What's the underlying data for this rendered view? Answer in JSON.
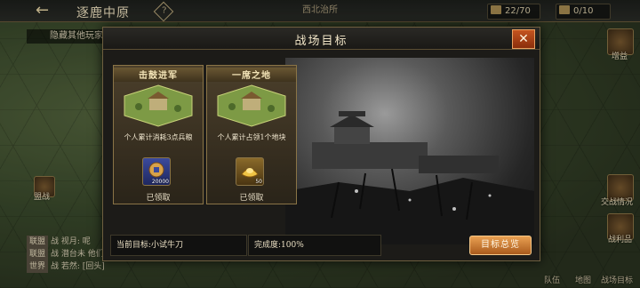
{
  "topbar": {
    "title": "逐鹿中原",
    "help": "?",
    "region": "西北治所",
    "resource1": "22/70",
    "resource2": "0/10"
  },
  "map": {
    "hide_label": "隐藏其他玩家",
    "side_buttons": [
      "增益",
      "交战情况",
      "战利品"
    ],
    "left_button": "盟战",
    "bottom_icons": [
      "队伍",
      "地图",
      "战场目标"
    ],
    "chat": [
      {
        "tag": "联盟",
        "text": "战 视月: 呢"
      },
      {
        "tag": "联盟",
        "text": "战 潜台未 他们"
      },
      {
        "tag": "世界",
        "text": "战 若然: [回头]"
      }
    ]
  },
  "dialog": {
    "title": "战场目标",
    "close": "✕",
    "cards": [
      {
        "title": "击鼓进军",
        "desc": "个人累计消耗3点兵粮",
        "reward_qty": "20000",
        "reward_type": "coin",
        "status": "已领取"
      },
      {
        "title": "一席之地",
        "desc": "个人累计占领1个地块",
        "reward_qty": "50",
        "reward_type": "gold-ingot",
        "status": "已领取"
      }
    ],
    "current_goal_label": "当前目标:",
    "current_goal_value": "小试牛刀",
    "progress_label": "完成度:",
    "progress_value": "100%",
    "summary_button": "目标总览"
  },
  "colors": {
    "accent": "#d98a3e",
    "close": "#b3481a"
  }
}
